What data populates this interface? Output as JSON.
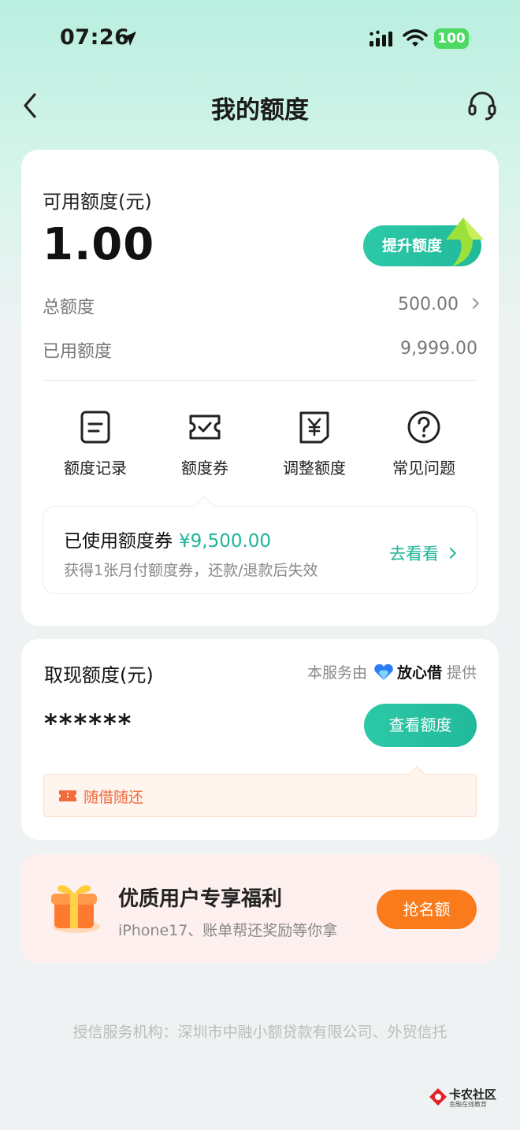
{
  "status_bar": {
    "time": "07:26",
    "battery": "100"
  },
  "nav": {
    "title": "我的额度"
  },
  "quota": {
    "available_label": "可用额度(元)",
    "available_value": "1.00",
    "raise_button": "提升额度",
    "total_label": "总额度",
    "total_value": "500.00",
    "used_label": "已用额度",
    "used_value": "9,999.00",
    "actions": [
      {
        "label": "额度记录",
        "icon": "document-icon"
      },
      {
        "label": "额度券",
        "icon": "ticket-check-icon"
      },
      {
        "label": "调整额度",
        "icon": "yuan-doc-icon"
      },
      {
        "label": "常见问题",
        "icon": "question-icon"
      }
    ],
    "coupon": {
      "title": "已使用额度券",
      "amount": "¥9,500.00",
      "description": "获得1张月付额度券，还款/退款后失效",
      "link": "去看看"
    }
  },
  "cash": {
    "label": "取现额度(元)",
    "provider_prefix": "本服务由",
    "provider_name": "放心借",
    "provider_suffix": "提供",
    "masked_value": "******",
    "view_button": "查看额度",
    "tag": "随借随还"
  },
  "benefit": {
    "title": "优质用户专享福利",
    "subtitle": "iPhone17、账单帮还奖励等你拿",
    "button": "抢名额"
  },
  "footer": {
    "note": "授信服务机构：深圳市中融小额贷款有限公司、外贸信托"
  },
  "watermark": {
    "name": "卡农社区",
    "sub": "金融在线教育"
  },
  "colors": {
    "accent": "#1fb597",
    "orange": "#f97b1c"
  }
}
